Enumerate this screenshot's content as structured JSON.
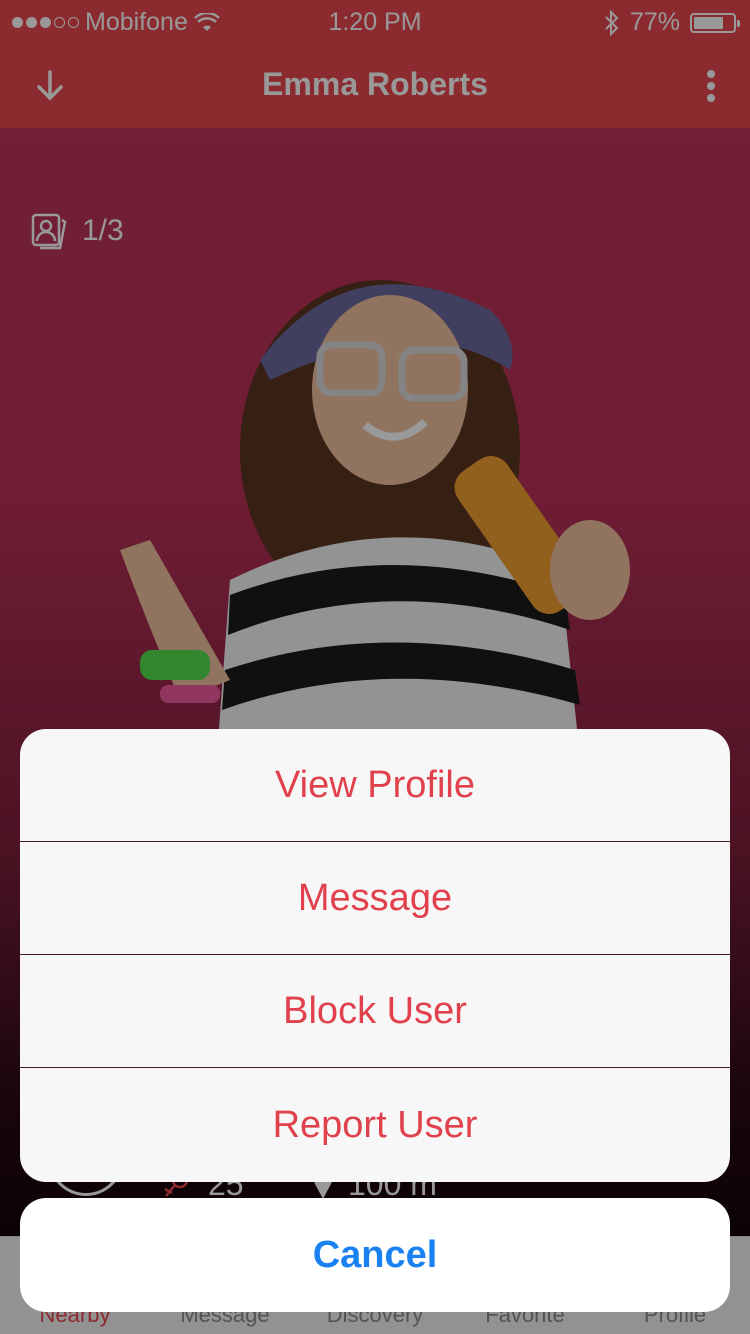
{
  "status_bar": {
    "carrier": "Mobifone",
    "time": "1:20 PM",
    "battery": "77%",
    "battery_level": 0.77
  },
  "nav": {
    "title": "Emma Roberts"
  },
  "photo": {
    "counter": "1/3"
  },
  "profile": {
    "age": "25",
    "distance": "100 m"
  },
  "action_sheet": {
    "items": [
      "View Profile",
      "Message",
      "Block User",
      "Report User"
    ],
    "cancel": "Cancel"
  },
  "tabs": [
    {
      "label": "Nearby",
      "active": true
    },
    {
      "label": "Message",
      "active": false
    },
    {
      "label": "Discovery",
      "active": false
    },
    {
      "label": "Favorite",
      "active": false
    },
    {
      "label": "Profile",
      "active": false
    }
  ],
  "colors": {
    "accent": "#e8474f",
    "sheet_text": "#e0414c",
    "cancel_text": "#1a82f0"
  }
}
